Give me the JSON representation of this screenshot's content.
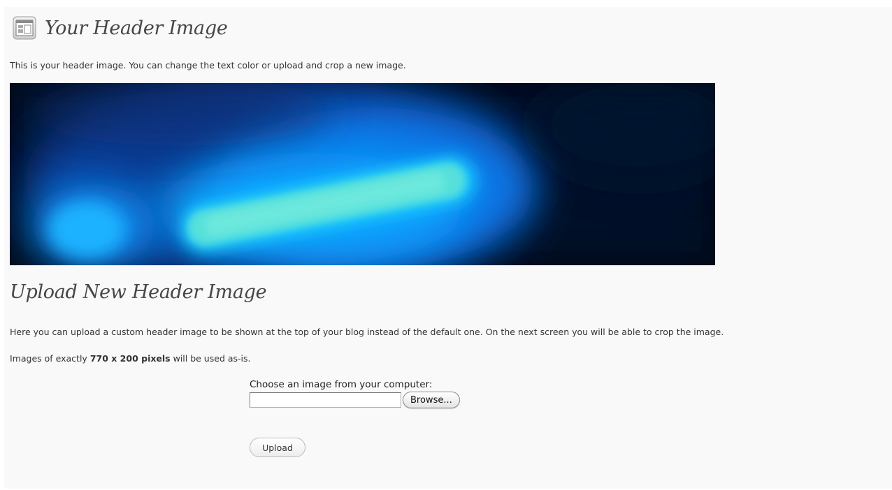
{
  "header_section": {
    "title": "Your Header Image",
    "intro": "This is your header image. You can change the text color or upload and crop a new image.",
    "icon": "appearance-icon"
  },
  "upload_section": {
    "title": "Upload New Header Image",
    "description": "Here you can upload a custom header image to be shown at the top of your blog instead of the default one. On the next screen you will be able to crop the image.",
    "size_note_prefix": "Images of exactly ",
    "size_note_bold": "770 x 200 pixels",
    "size_note_suffix": " will be used as-is.",
    "choose_label": "Choose an image from your computer:",
    "file_value": "",
    "browse_label": "Browse...",
    "upload_label": "Upload"
  },
  "colors": {
    "page_background": "#f9f9f9",
    "heading": "#464646",
    "image_glow": "#00a8ff",
    "image_highlight": "#5fe8d8"
  }
}
